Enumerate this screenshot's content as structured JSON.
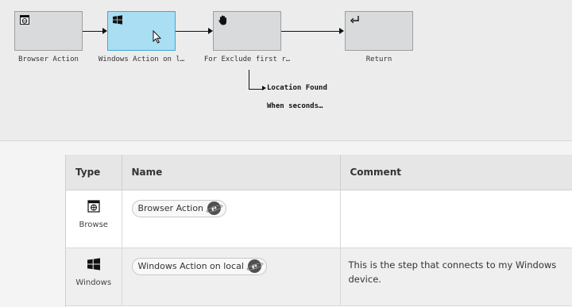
{
  "flow": {
    "nodes": [
      {
        "label": "Browser Action",
        "icon": "browser-icon",
        "selected": false
      },
      {
        "label": "Windows Action on l…",
        "icon": "windows-icon",
        "selected": true
      },
      {
        "label": "For Exclude first r…",
        "icon": "hand-icon",
        "selected": false
      },
      {
        "label": "Return",
        "icon": "return-arrow-icon",
        "selected": false
      }
    ],
    "branch": {
      "label": "Location Found",
      "condition": "When seconds…"
    }
  },
  "table": {
    "columns": [
      "Type",
      "Name",
      "Comment"
    ],
    "rows": [
      {
        "type_icon": "browser-icon",
        "type_label": "Browse",
        "name": "Browser Action",
        "name_badge_icon": "internet-explorer-icon",
        "comment": ""
      },
      {
        "type_icon": "windows-icon",
        "type_label": "Windows",
        "name": "Windows Action on local",
        "name_badge_icon": "internet-explorer-icon",
        "comment": "This is the step that connects to my Windows device."
      }
    ]
  },
  "colors": {
    "selected_node": "#a9def3",
    "selected_border": "#44a6d6",
    "node": "#d8dadb"
  }
}
